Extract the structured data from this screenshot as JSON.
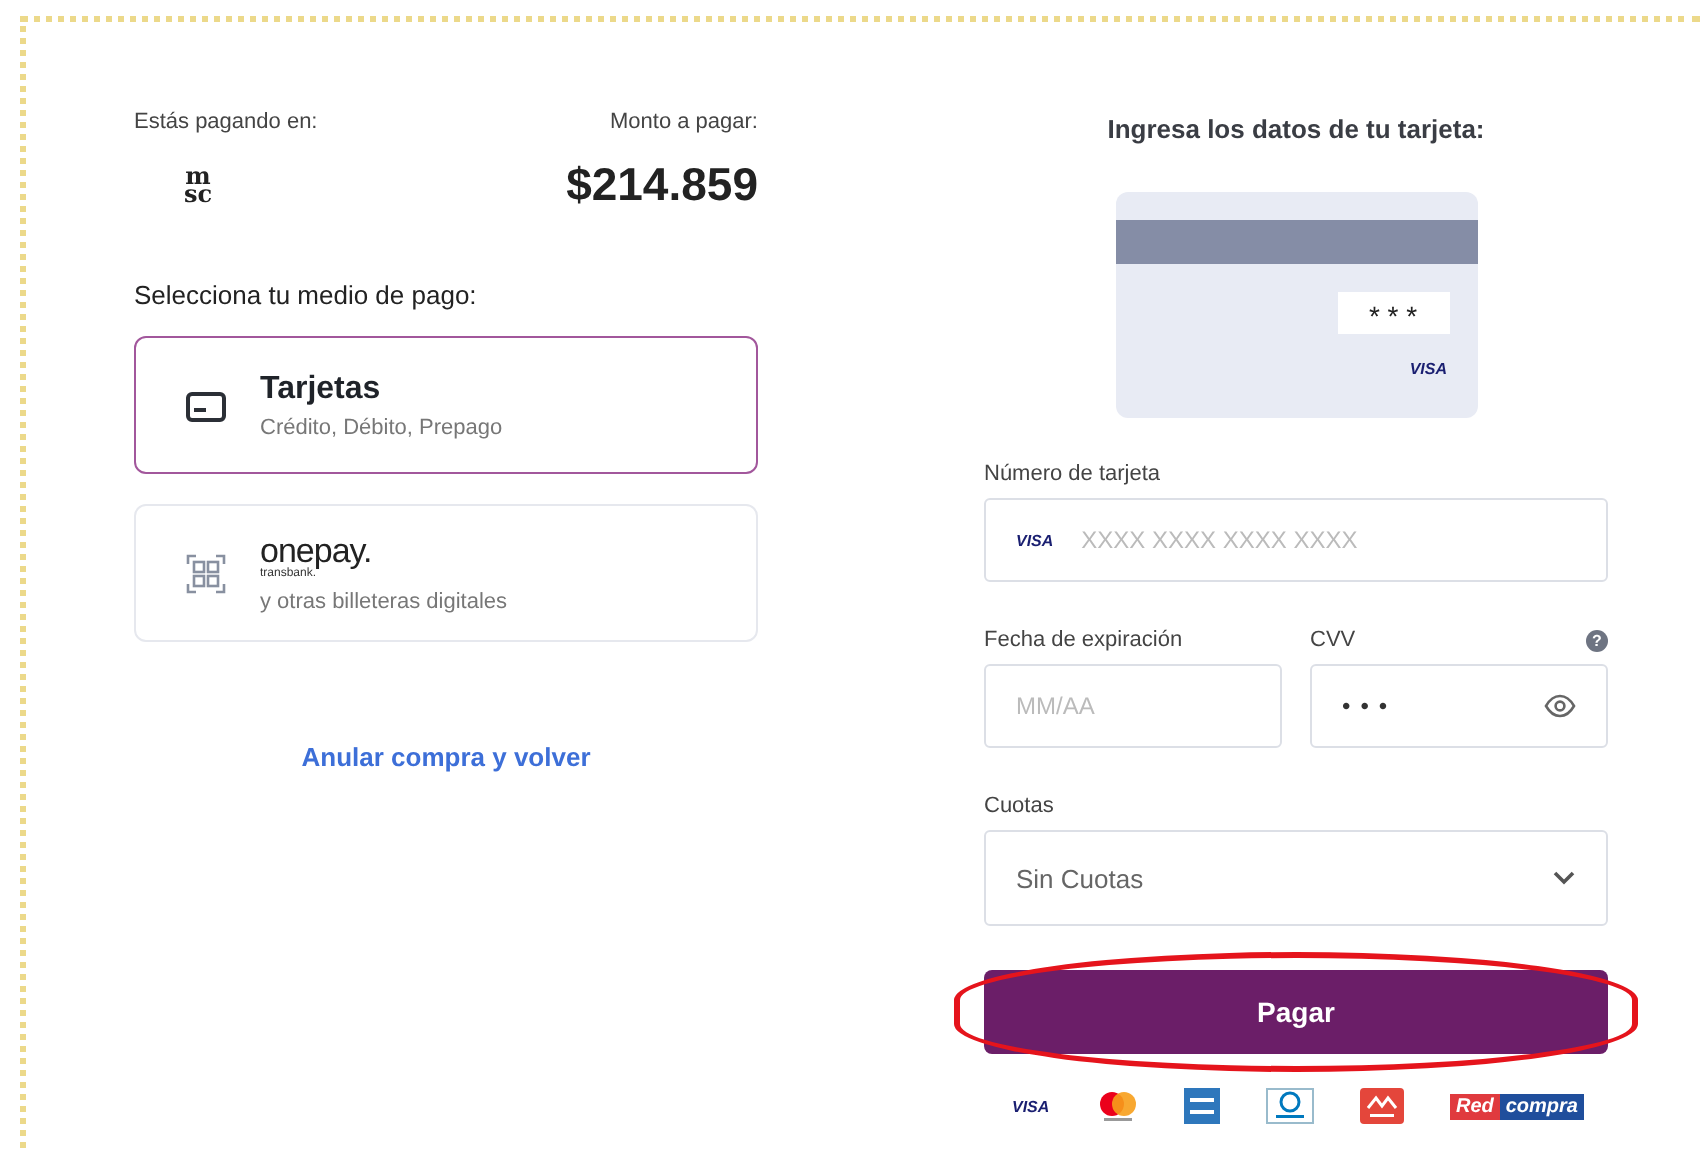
{
  "merchant": {
    "label": "Estás pagando en:",
    "logo_top": "m",
    "logo_bottom": "sc"
  },
  "amount": {
    "label": "Monto a pagar:",
    "value": "$214.859"
  },
  "methods_title": "Selecciona tu medio de pago:",
  "methods": [
    {
      "kind": "card",
      "title": "Tarjetas",
      "subtitle": "Crédito, Débito, Prepago",
      "selected": true
    },
    {
      "kind": "wallet",
      "title": "onepay.",
      "brand_small": "transbank.",
      "subtitle": "y otras billeteras digitales",
      "selected": false
    }
  ],
  "cancel_link": "Anular compra y volver",
  "card_form": {
    "title": "Ingresa los datos de tu tarjeta:",
    "card_preview": {
      "cvv_mask": "* * *",
      "brand": "VISA"
    },
    "number": {
      "label": "Número de tarjeta",
      "brand": "VISA",
      "placeholder": "XXXX XXXX XXXX XXXX"
    },
    "expiry": {
      "label": "Fecha de expiración",
      "placeholder": "MM/AA"
    },
    "cvv": {
      "label": "CVV",
      "value": "•••",
      "help": "?"
    },
    "installments": {
      "label": "Cuotas",
      "value": "Sin Cuotas"
    },
    "pay_button": {
      "label": "Pagar",
      "highlighted": true
    },
    "accepted": [
      {
        "kind": "visa",
        "text": "VISA"
      },
      {
        "kind": "mastercard"
      },
      {
        "kind": "amex"
      },
      {
        "kind": "diners"
      },
      {
        "kind": "magna"
      },
      {
        "kind": "redcompra",
        "text": "Red",
        "text2": "compra"
      }
    ]
  }
}
